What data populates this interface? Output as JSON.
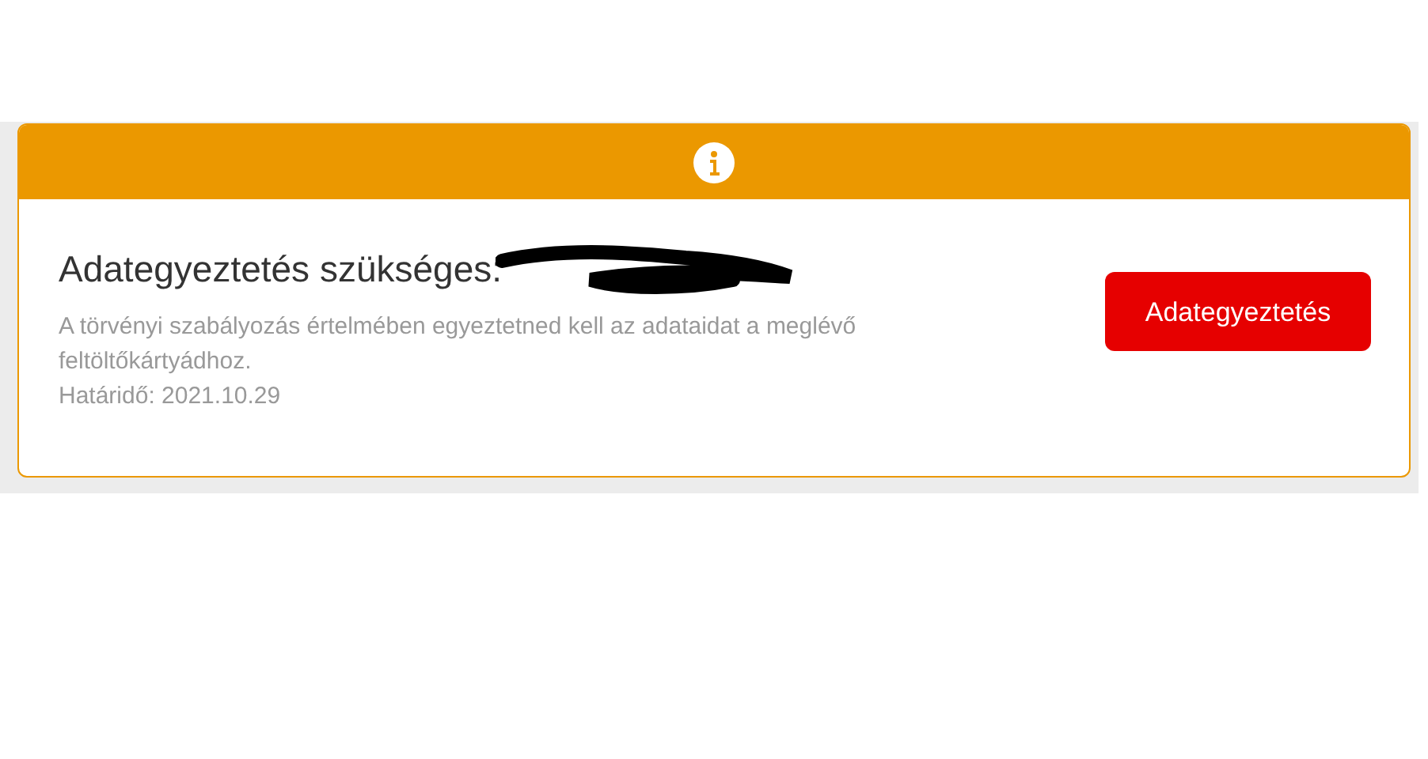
{
  "notice": {
    "title": "Adategyeztetés szükséges:",
    "redacted": true,
    "message": "A törvényi szabályozás értelmében egyeztetned kell az adataidat a meglévő feltöltőkártyádhoz.",
    "deadline": "Határidő: 2021.10.29",
    "button": "Adategyeztetés"
  }
}
